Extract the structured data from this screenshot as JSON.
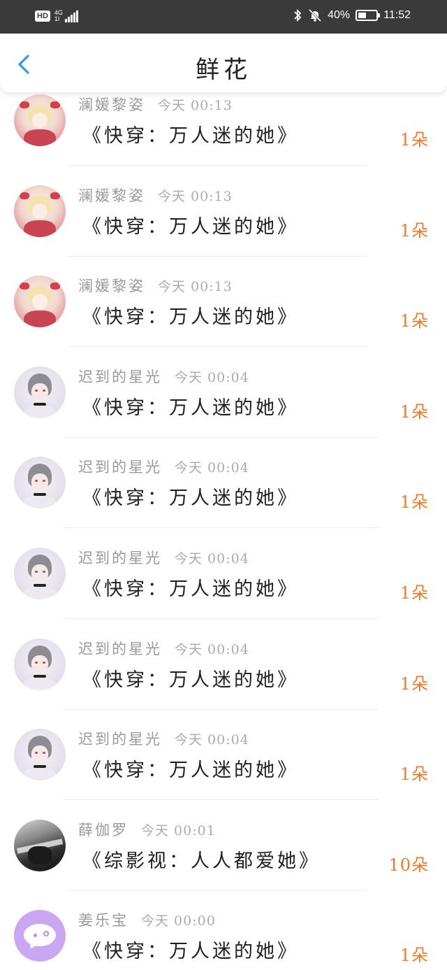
{
  "status_bar": {
    "hd_label": "HD",
    "network_label": "4G",
    "network_sub": "1I",
    "battery_text": "40%",
    "battery_level": 0.4,
    "time": "11:52",
    "icons": [
      "bluetooth-icon",
      "mute-bell-icon",
      "battery-icon"
    ]
  },
  "header": {
    "title": "鲜花",
    "back_icon": "chevron-left-icon",
    "accent_color": "#2f9bf0"
  },
  "items": [
    {
      "user": "澜媛黎姿",
      "time": "今天 00:13",
      "book": "《快穿：万人迷的她》",
      "count": "1朵",
      "avatar": "anime-girl"
    },
    {
      "user": "澜媛黎姿",
      "time": "今天 00:13",
      "book": "《快穿：万人迷的她》",
      "count": "1朵",
      "avatar": "anime-girl"
    },
    {
      "user": "澜媛黎姿",
      "time": "今天 00:13",
      "book": "《快穿：万人迷的她》",
      "count": "1朵",
      "avatar": "anime-girl"
    },
    {
      "user": "迟到的星光",
      "time": "今天 00:04",
      "book": "《快穿：万人迷的她》",
      "count": "1朵",
      "avatar": "anime-boy"
    },
    {
      "user": "迟到的星光",
      "time": "今天 00:04",
      "book": "《快穿：万人迷的她》",
      "count": "1朵",
      "avatar": "anime-boy"
    },
    {
      "user": "迟到的星光",
      "time": "今天 00:04",
      "book": "《快穿：万人迷的她》",
      "count": "1朵",
      "avatar": "anime-boy"
    },
    {
      "user": "迟到的星光",
      "time": "今天 00:04",
      "book": "《快穿：万人迷的她》",
      "count": "1朵",
      "avatar": "anime-boy"
    },
    {
      "user": "迟到的星光",
      "time": "今天 00:04",
      "book": "《快穿：万人迷的她》",
      "count": "1朵",
      "avatar": "anime-boy"
    },
    {
      "user": "薛伽罗",
      "time": "今天 00:01",
      "book": "《综影视：人人都爱她》",
      "count": "10朵",
      "avatar": "dark-photo"
    },
    {
      "user": "姜乐宝",
      "time": "今天 00:00",
      "book": "《快穿：万人迷的她》",
      "count": "1朵",
      "avatar": "chat-bubble"
    }
  ],
  "colors": {
    "count": "#f07a2a",
    "status_bar_bg": "#3a3a3a",
    "meta_text": "#9a9a9a"
  }
}
